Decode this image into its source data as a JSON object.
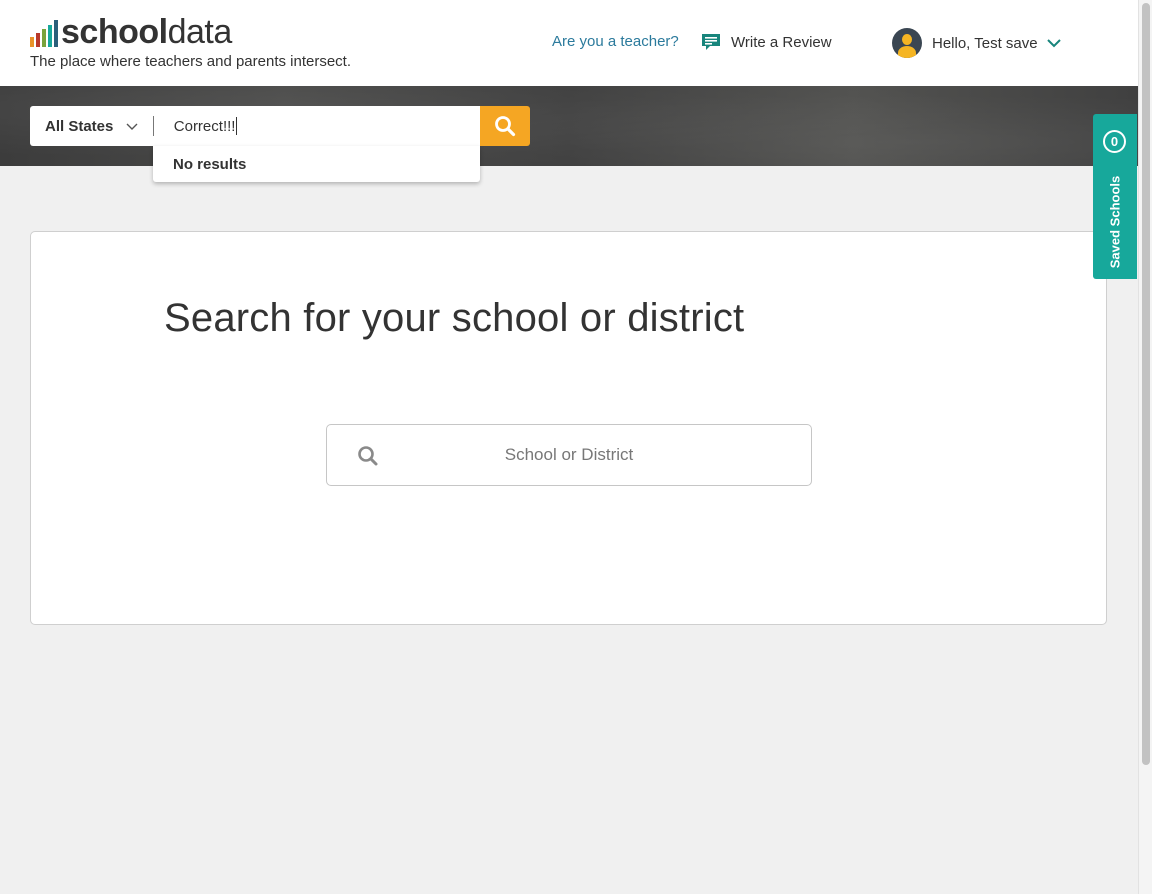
{
  "brand": {
    "name_bold": "school",
    "name_light": "data",
    "tagline": "The place where teachers and parents intersect.",
    "bar_colors": [
      "#e8932a",
      "#b8382b",
      "#7aa33c",
      "#17a89b",
      "#2b5f7a"
    ]
  },
  "nav": {
    "teacher_link": "Are you a teacher?",
    "review_link": "Write a Review",
    "review_icon": "speech-bubble-icon",
    "user_greeting": "Hello, Test save",
    "user_icon": "avatar-icon"
  },
  "search": {
    "state_label": "All States",
    "query": "Correct!!!",
    "dropdown_message": "No results"
  },
  "saved_schools": {
    "count": "0",
    "label": "Saved Schools"
  },
  "main": {
    "title": "Search for your school or district",
    "placeholder": "School or District"
  },
  "colors": {
    "accent_orange": "#f5a623",
    "accent_teal": "#17a89b",
    "link_blue": "#2b7a9c"
  }
}
